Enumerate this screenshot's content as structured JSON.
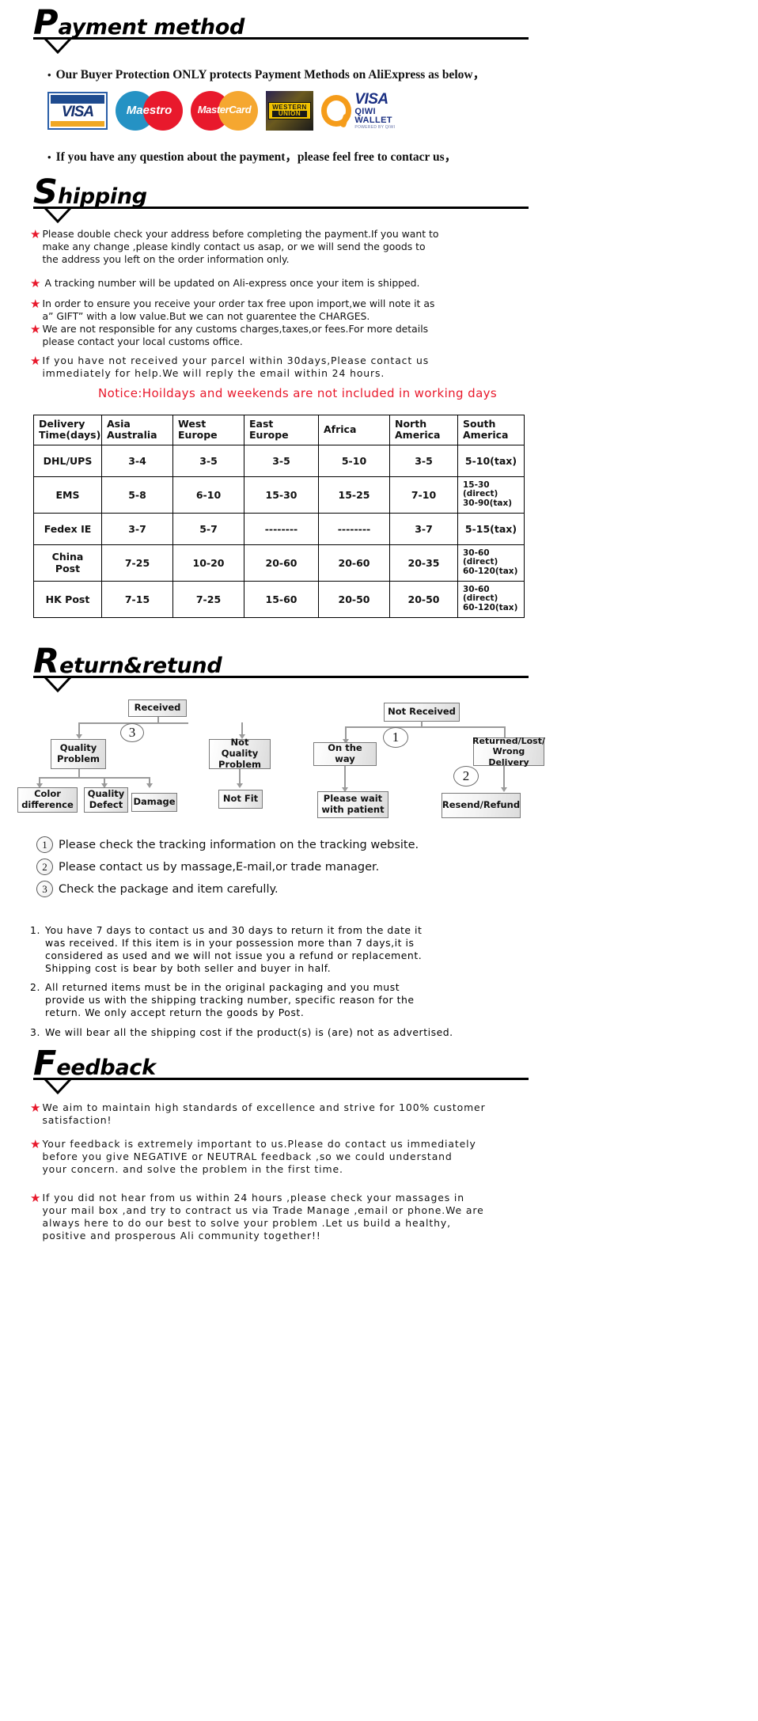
{
  "sections": {
    "payment": {
      "cap": "P",
      "rest": "ayment method"
    },
    "shipping": {
      "cap": "S",
      "rest": "hipping"
    },
    "return": {
      "cap": "R",
      "rest": "eturn&retund"
    },
    "feedback": {
      "cap": "F",
      "rest": "eedback"
    }
  },
  "payment": {
    "bullet1": "Our Buyer Protection ONLY protects Payment Methods on AliExpress as below，",
    "bullet2": "If you have any question about the payment，please feel free to contacr us，",
    "logos": [
      {
        "name": "visa-logo",
        "text": "VISA"
      },
      {
        "name": "maestro-logo",
        "text": "Maestro"
      },
      {
        "name": "mastercard-logo",
        "text": "MasterCard"
      },
      {
        "name": "western-union-logo",
        "line1": "WESTERN",
        "line2": "UNION"
      },
      {
        "name": "qiwi-wallet-logo",
        "visa": "VISA",
        "wallet": "QIWI WALLET",
        "powered": "POWERED BY QIWI"
      }
    ]
  },
  "shipping": {
    "bullets": [
      "Please double check your address before completing the payment.If you want to\nmake any change ,please kindly contact us asap, or we will send the goods to\nthe address you left on the order information only.",
      "A tracking number will be updated on Ali-express once your item is shipped.",
      "In order to ensure you receive your order tax free upon import,we will note it as\na” GIFT” with a low value.But we can not guarentee the CHARGES.",
      "We are not responsible for any customs charges,taxes,or fees.For more details\nplease contact your local customs office.",
      "If you have not received your parcel within 30days,Please contact us\nimmediately for help.We will reply the email within 24 hours."
    ],
    "notice": "Notice:Hoildays and  weekends  are  not  included  in  working  days",
    "table": {
      "headers": [
        "Delivery\nTime(days)",
        "Asia\nAustralia",
        "West\nEurope",
        "East\nEurope",
        "Africa",
        "North\nAmerica",
        "South\nAmerica"
      ],
      "rows": [
        {
          "method": "DHL/UPS",
          "cells": [
            "3-4",
            "3-5",
            "3-5",
            "5-10",
            "3-5",
            "5-10(tax)"
          ]
        },
        {
          "method": "EMS",
          "cells": [
            "5-8",
            "6-10",
            "15-30",
            "15-25",
            "7-10",
            "15-30\n(direct)\n30-90(tax)"
          ]
        },
        {
          "method": "Fedex IE",
          "cells": [
            "3-7",
            "5-7",
            "--------",
            "--------",
            "3-7",
            "5-15(tax)"
          ]
        },
        {
          "method": "China Post",
          "cells": [
            "7-25",
            "10-20",
            "20-60",
            "20-60",
            "20-35",
            "30-60\n(direct)\n60-120(tax)"
          ]
        },
        {
          "method": "HK Post",
          "cells": [
            "7-15",
            "7-25",
            "15-60",
            "20-50",
            "20-50",
            "30-60\n(direct)\n60-120(tax)"
          ]
        }
      ]
    }
  },
  "returnflow": {
    "left": {
      "root": "Received",
      "marker": "3",
      "branch_quality": "Quality\nProblem",
      "branch_not_quality": "Not Quality\nProblem",
      "leaf_color": "Color\ndifference",
      "leaf_defect": "Quality\nDefect",
      "leaf_damage": "Damage",
      "leaf_notfit": "Not Fit"
    },
    "right": {
      "root": "Not  Received",
      "marker1": "1",
      "marker2": "2",
      "branch_onway": "On the way",
      "branch_returned": "Returned/Lost/\nWrong Delivery",
      "leaf_wait": "Please wait\nwith patient",
      "leaf_resend": "Resend/Refund"
    },
    "legend": [
      {
        "num": "1",
        "text": "Please check the tracking information on the tracking website."
      },
      {
        "num": "2",
        "text": "Please contact us by  massage,E-mail,or trade manager."
      },
      {
        "num": "3",
        "text": "Check the package and item carefully."
      }
    ],
    "policies": [
      {
        "num": "1.",
        "text": "You have 7 days to contact us and 30 days to return it from the date it\nwas received. If this item is in your possession more than 7 days,it is\nconsidered as used and we will not issue you a refund or replacement.\nShipping cost is bear by both seller and buyer in half."
      },
      {
        "num": "2.",
        "text": "All returned items must be in the original packaging and you must\nprovide us with the shipping tracking number, specific reason for the\nreturn. We only accept return the goods by Post."
      },
      {
        "num": "3.",
        "text": "We will bear all the shipping cost if the product(s) is (are) not as advertised."
      }
    ]
  },
  "feedback": {
    "bullets": [
      "We aim to  maintain high standards of excellence and strive  for 100% customer\nsatisfaction!",
      "Your feedback is extremely important to us.Please do contact us immediately\nbefore you give NEGATIVE or NEUTRAL feedback ,so  we  could understand\nyour concern. and solve the problem in the first time.",
      "If you did not hear from us within 24 hours ,please check your massages in\nyour mail box ,and  try to contract us via Trade Manage ,email or phone.We are\nalways here to do our best to solve your problem .Let us build a healthy,\npositive and prosperous Ali community together!!"
    ]
  },
  "colors": {
    "star_red": "#e8192c",
    "notice_red": "#e8192c",
    "rule_black": "#000000",
    "flow_border": "#7a7a7a"
  }
}
